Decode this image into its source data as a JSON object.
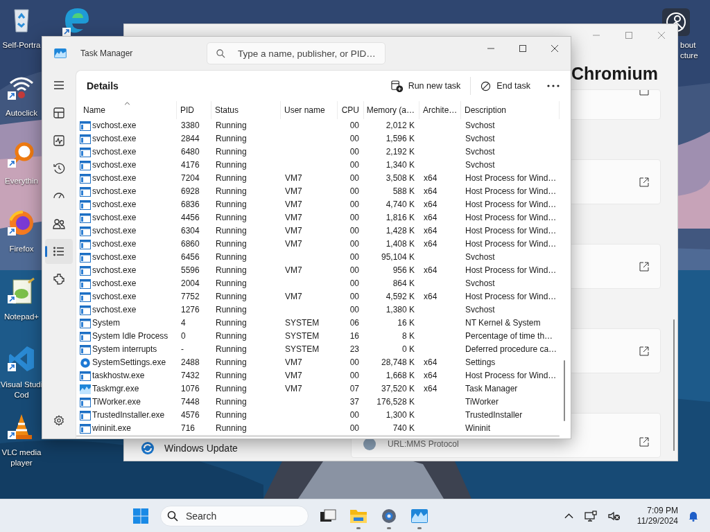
{
  "desktop": {
    "icons": [
      {
        "kind": "recycle",
        "shortcut": false,
        "label_lines": [
          "Self-Portra"
        ]
      },
      {
        "kind": "wifi",
        "shortcut": true,
        "label_lines": [
          "Autoclick"
        ]
      },
      {
        "kind": "magnifier",
        "shortcut": true,
        "label_lines": [
          "Everythin"
        ]
      },
      {
        "kind": "firefox",
        "shortcut": true,
        "label_lines": [
          "Firefox"
        ]
      },
      {
        "kind": "notepad",
        "shortcut": true,
        "label_lines": [
          "Notepad+"
        ]
      },
      {
        "kind": "vscode",
        "shortcut": true,
        "label_lines": [
          "Visual Studi",
          "Cod"
        ]
      },
      {
        "kind": "vlc",
        "shortcut": true,
        "label_lines": [
          "VLC media",
          "player"
        ]
      }
    ],
    "right_icon": {
      "label_lines": [
        "bout",
        "cture"
      ]
    }
  },
  "background_window": {
    "heading": "Chromium",
    "left_item": "Windows Update",
    "card_text": "URL:MMS Protocol"
  },
  "task_manager": {
    "title": "Task Manager",
    "search": {
      "placeholder": "Type a name, publisher, or PID…"
    },
    "nav": [
      {
        "kind": "processes",
        "selected": false
      },
      {
        "kind": "performance",
        "selected": false
      },
      {
        "kind": "history",
        "selected": false
      },
      {
        "kind": "startup",
        "selected": false
      },
      {
        "kind": "users",
        "selected": false
      },
      {
        "kind": "details",
        "selected": true
      },
      {
        "kind": "services",
        "selected": false
      }
    ],
    "page_title": "Details",
    "actions": [
      {
        "kind": "run",
        "label": "Run new task"
      },
      {
        "kind": "end",
        "label": "End task"
      }
    ],
    "table": {
      "columns": [
        {
          "label": "Name",
          "sorted": true
        },
        {
          "label": "PID",
          "sorted": false
        },
        {
          "label": "Status",
          "sorted": false
        },
        {
          "label": "User name",
          "sorted": false
        },
        {
          "label": "CPU",
          "sorted": false
        },
        {
          "label": "Memory (a…",
          "sorted": false
        },
        {
          "label": "Archite…",
          "sorted": false
        },
        {
          "label": "Description",
          "sorted": false
        }
      ],
      "rows": [
        {
          "kind": "service",
          "name": "svchost.exe",
          "pid": "3380",
          "status": "Running",
          "cpu": "00",
          "memory": "2,012 K",
          "description": "Svchost"
        },
        {
          "kind": "service",
          "name": "svchost.exe",
          "pid": "2844",
          "status": "Running",
          "cpu": "00",
          "memory": "1,596 K",
          "description": "Svchost"
        },
        {
          "kind": "service",
          "name": "svchost.exe",
          "pid": "6480",
          "status": "Running",
          "cpu": "00",
          "memory": "2,192 K",
          "description": "Svchost"
        },
        {
          "kind": "service",
          "name": "svchost.exe",
          "pid": "4176",
          "status": "Running",
          "cpu": "00",
          "memory": "1,340 K",
          "description": "Svchost"
        },
        {
          "kind": "service",
          "name": "svchost.exe",
          "pid": "7204",
          "status": "Running",
          "user": "VM7",
          "cpu": "00",
          "memory": "3,508 K",
          "arch": "x64",
          "description": "Host Process for Wind…"
        },
        {
          "kind": "service",
          "name": "svchost.exe",
          "pid": "6928",
          "status": "Running",
          "user": "VM7",
          "cpu": "00",
          "memory": "588 K",
          "arch": "x64",
          "description": "Host Process for Wind…"
        },
        {
          "kind": "service",
          "name": "svchost.exe",
          "pid": "6836",
          "status": "Running",
          "user": "VM7",
          "cpu": "00",
          "memory": "4,740 K",
          "arch": "x64",
          "description": "Host Process for Wind…"
        },
        {
          "kind": "service",
          "name": "svchost.exe",
          "pid": "4456",
          "status": "Running",
          "user": "VM7",
          "cpu": "00",
          "memory": "1,816 K",
          "arch": "x64",
          "description": "Host Process for Wind…"
        },
        {
          "kind": "service",
          "name": "svchost.exe",
          "pid": "6304",
          "status": "Running",
          "user": "VM7",
          "cpu": "00",
          "memory": "1,428 K",
          "arch": "x64",
          "description": "Host Process for Wind…"
        },
        {
          "kind": "service",
          "name": "svchost.exe",
          "pid": "6860",
          "status": "Running",
          "user": "VM7",
          "cpu": "00",
          "memory": "1,408 K",
          "arch": "x64",
          "description": "Host Process for Wind…"
        },
        {
          "kind": "service",
          "name": "svchost.exe",
          "pid": "6456",
          "status": "Running",
          "cpu": "00",
          "memory": "95,104 K",
          "description": "Svchost"
        },
        {
          "kind": "service",
          "name": "svchost.exe",
          "pid": "5596",
          "status": "Running",
          "user": "VM7",
          "cpu": "00",
          "memory": "956 K",
          "arch": "x64",
          "description": "Host Process for Wind…"
        },
        {
          "kind": "service",
          "name": "svchost.exe",
          "pid": "2004",
          "status": "Running",
          "cpu": "00",
          "memory": "864 K",
          "description": "Svchost"
        },
        {
          "kind": "service",
          "name": "svchost.exe",
          "pid": "7752",
          "status": "Running",
          "user": "VM7",
          "cpu": "00",
          "memory": "4,592 K",
          "arch": "x64",
          "description": "Host Process for Wind…"
        },
        {
          "kind": "service",
          "name": "svchost.exe",
          "pid": "1276",
          "status": "Running",
          "cpu": "00",
          "memory": "1,380 K",
          "description": "Svchost"
        },
        {
          "kind": "service",
          "name": "System",
          "pid": "4",
          "status": "Running",
          "user": "SYSTEM",
          "cpu": "06",
          "memory": "16 K",
          "description": "NT Kernel & System"
        },
        {
          "kind": "service",
          "name": "System Idle Process",
          "pid": "0",
          "status": "Running",
          "user": "SYSTEM",
          "cpu": "16",
          "memory": "8 K",
          "description": "Percentage of time th…"
        },
        {
          "kind": "service",
          "name": "System interrupts",
          "pid": "-",
          "status": "Running",
          "user": "SYSTEM",
          "cpu": "23",
          "memory": "0 K",
          "description": "Deferred procedure ca…"
        },
        {
          "kind": "settings",
          "name": "SystemSettings.exe",
          "pid": "2488",
          "status": "Running",
          "user": "VM7",
          "cpu": "00",
          "memory": "28,748 K",
          "arch": "x64",
          "description": "Settings"
        },
        {
          "kind": "service",
          "name": "taskhostw.exe",
          "pid": "7432",
          "status": "Running",
          "user": "VM7",
          "cpu": "00",
          "memory": "1,668 K",
          "arch": "x64",
          "description": "Host Process for Wind…"
        },
        {
          "kind": "taskmgr",
          "name": "Taskmgr.exe",
          "pid": "1076",
          "status": "Running",
          "user": "VM7",
          "cpu": "07",
          "memory": "37,520 K",
          "arch": "x64",
          "description": "Task Manager"
        },
        {
          "kind": "service",
          "name": "TiWorker.exe",
          "pid": "7448",
          "status": "Running",
          "cpu": "37",
          "memory": "176,528 K",
          "description": "TiWorker"
        },
        {
          "kind": "service",
          "name": "TrustedInstaller.exe",
          "pid": "4576",
          "status": "Running",
          "cpu": "00",
          "memory": "1,300 K",
          "description": "TrustedInstaller"
        },
        {
          "kind": "service",
          "name": "wininit.exe",
          "pid": "716",
          "status": "Running",
          "cpu": "00",
          "memory": "740 K",
          "description": "Wininit"
        }
      ]
    }
  },
  "taskbar": {
    "search": {
      "placeholder": "Search"
    },
    "apps": [
      {
        "kind": "taskview",
        "running": false
      },
      {
        "kind": "explorer",
        "running": true
      },
      {
        "kind": "settings",
        "running": true
      },
      {
        "kind": "taskmgr",
        "running": true
      }
    ],
    "time": "7:09 PM",
    "date": "11/29/2024"
  }
}
